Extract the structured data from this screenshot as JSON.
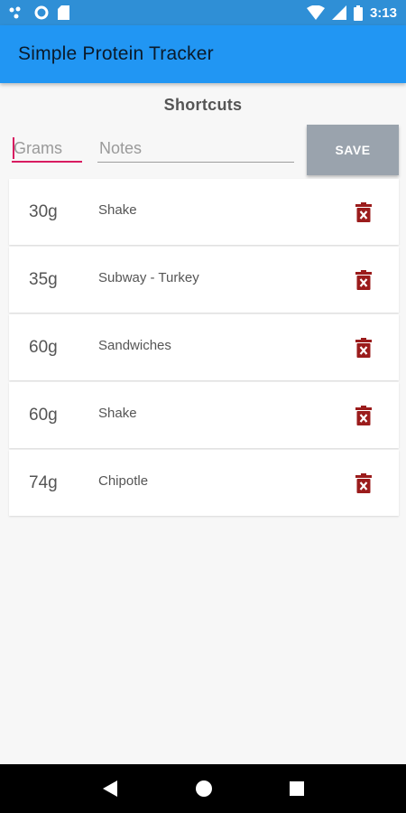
{
  "status_bar": {
    "time": "3:13"
  },
  "app_bar": {
    "title": "Simple Protein Tracker"
  },
  "section": {
    "title": "Shortcuts"
  },
  "form": {
    "grams_placeholder": "Grams",
    "notes_placeholder": "Notes",
    "save_label": "SAVE"
  },
  "items": [
    {
      "grams": "30g",
      "note": "Shake"
    },
    {
      "grams": "35g",
      "note": "Subway - Turkey"
    },
    {
      "grams": "60g",
      "note": "Sandwiches"
    },
    {
      "grams": "60g",
      "note": "Shake"
    },
    {
      "grams": "74g",
      "note": "Chipotle"
    }
  ],
  "colors": {
    "app_bar": "#2196f3",
    "status_bar": "#2f8fd6",
    "accent": "#d81b60",
    "save_button": "#9aa3ad",
    "delete_icon": "#9b1c1c"
  },
  "icons": [
    "notification-dots-icon",
    "circle-notification-icon",
    "sd-card-icon",
    "wifi-icon",
    "signal-icon",
    "battery-icon",
    "trash-delete-icon",
    "back-icon",
    "home-icon",
    "recents-icon"
  ]
}
